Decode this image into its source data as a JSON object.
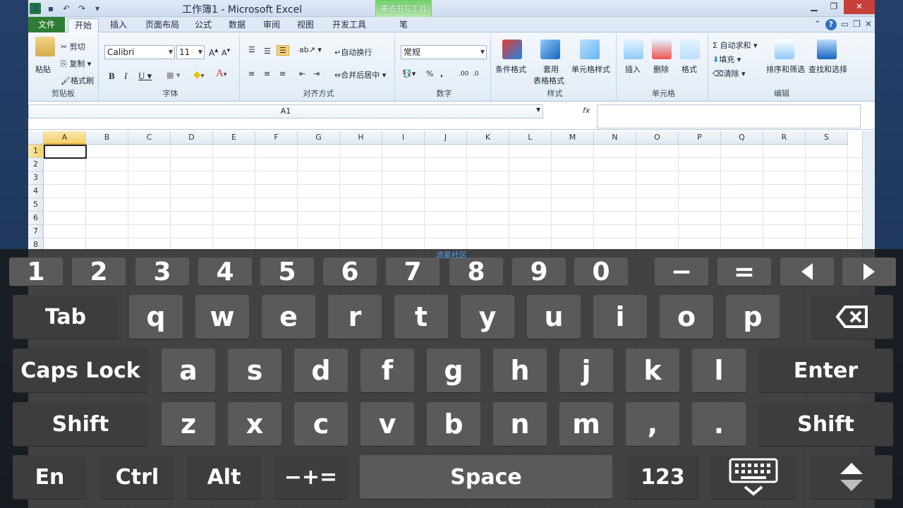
{
  "window": {
    "title": "工作簿1 - Microsoft Excel",
    "context_tab_title": "墨迹书写工具"
  },
  "tabs": [
    {
      "label": "文件"
    },
    {
      "label": "开始"
    },
    {
      "label": "插入"
    },
    {
      "label": "页面布局"
    },
    {
      "label": "公式"
    },
    {
      "label": "数据"
    },
    {
      "label": "审阅"
    },
    {
      "label": "视图"
    },
    {
      "label": "开发工具"
    },
    {
      "label": "笔"
    }
  ],
  "ribbon": {
    "clipboard": {
      "paste": "粘贴",
      "cut": "剪切",
      "copy": "复制",
      "format_painter": "格式刷",
      "name": "剪贴板"
    },
    "font": {
      "family": "Calibri",
      "size": "11",
      "name": "字体"
    },
    "alignment": {
      "wrap": "自动换行",
      "merge": "合并后居中",
      "name": "对齐方式"
    },
    "number": {
      "format": "常规",
      "name": "数字"
    },
    "styles": {
      "conditional": "条件格式",
      "table_a": "套用",
      "table_b": "表格格式",
      "cell_styles": "单元格样式",
      "name": "样式"
    },
    "cells": {
      "insert": "插入",
      "delete": "删除",
      "format": "格式",
      "name": "单元格"
    },
    "editing": {
      "autosum": "自动求和",
      "fill": "填充",
      "clear": "清除",
      "sort": "排序和筛选",
      "find": "查找和选择",
      "name": "编辑"
    }
  },
  "formula_bar": {
    "name_box": "A1",
    "fx": "fx"
  },
  "sheet": {
    "columns": [
      "A",
      "B",
      "C",
      "D",
      "E",
      "F",
      "G",
      "H",
      "I",
      "J",
      "K",
      "L",
      "M",
      "N",
      "O",
      "P",
      "Q",
      "R",
      "S"
    ],
    "rows": [
      "1",
      "2",
      "3",
      "4",
      "5",
      "6",
      "7",
      "8"
    ],
    "active_cell": "A1"
  },
  "watermark": "流星社区",
  "keyboard": {
    "row1": [
      "1",
      "2",
      "3",
      "4",
      "5",
      "6",
      "7",
      "8",
      "9",
      "0",
      "−",
      "="
    ],
    "row2_tab": "Tab",
    "row2": [
      "q",
      "w",
      "e",
      "r",
      "t",
      "y",
      "u",
      "i",
      "o",
      "p"
    ],
    "row3_caps": "Caps Lock",
    "row3": [
      "a",
      "s",
      "d",
      "f",
      "g",
      "h",
      "j",
      "k",
      "l"
    ],
    "row3_enter": "Enter",
    "row4_shift": "Shift",
    "row4": [
      "z",
      "x",
      "c",
      "v",
      "b",
      "n",
      "m",
      ",",
      "."
    ],
    "row5": {
      "en": "En",
      "ctrl": "Ctrl",
      "alt": "Alt",
      "sym": "−+=",
      "space": "Space",
      "num": "123"
    }
  }
}
